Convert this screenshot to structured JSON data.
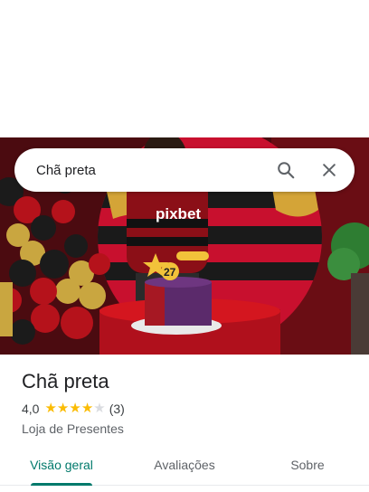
{
  "search": {
    "query": "Chã preta"
  },
  "icons": {
    "search": "search-icon",
    "close": "close-icon"
  },
  "place": {
    "name": "Chã preta",
    "rating": "4,0",
    "stars_filled": 4,
    "stars_total": 5,
    "review_count": "(3)",
    "category": "Loja de Presentes"
  },
  "photo_text": {
    "shirt_brand": "pixbet",
    "cake_number": "27"
  },
  "tabs": [
    {
      "label": "Visão geral",
      "active": true
    },
    {
      "label": "Avaliações",
      "active": false
    },
    {
      "label": "Sobre",
      "active": false
    }
  ],
  "colors": {
    "accent": "#00796b",
    "star": "#fbbc04",
    "brand_red": "#c8102e"
  }
}
